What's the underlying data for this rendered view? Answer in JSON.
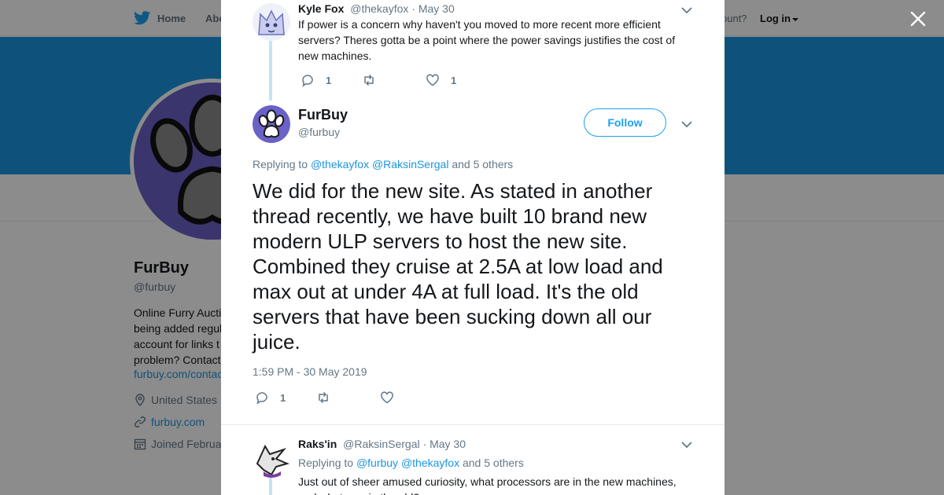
{
  "background": {
    "nav": {
      "home_label": "Home",
      "about_label": "Abo",
      "account_prompt": "ccount?",
      "login_label": "Log in"
    },
    "profile": {
      "name": "FurBuy",
      "handle": "@furbuy",
      "bio": "Online Furry Aucti\nbeing added regul\naccount for links t\nproblem? Contact",
      "bio_link": "furbuy.com/contac",
      "location": "United States",
      "website": "furbuy.com",
      "joined": "Joined Februa"
    },
    "colors": {
      "banner": "#1b95e0",
      "link": "#1b95e0",
      "avatar_purple": "#6a62c7"
    }
  },
  "modal": {
    "parent_tweet": {
      "name": "Kyle Fox",
      "handle": "@thekayfox",
      "date": "· May 30",
      "text": "If power is a concern why haven't you moved to more recent more efficient servers?  Theres gotta be a point where the power savings justifies the cost of new machines.",
      "reply_count": "1",
      "retweet_count": "",
      "like_count": "1"
    },
    "main_tweet": {
      "name": "FurBuy",
      "handle": "@furbuy",
      "follow_label": "Follow",
      "replying_prefix": "Replying to",
      "mention_1": "@thekayfox",
      "mention_2": "@RaksinSergal",
      "replying_suffix": "and 5 others",
      "text": "We did for the new site. As stated in another thread recently, we have built 10 brand new modern ULP servers to host the new site. Combined they cruise at 2.5A at low load and max out at under 4A at full load. It's the old servers that have been sucking down all our juice.",
      "timestamp": "1:59 PM - 30 May 2019",
      "reply_count": "1",
      "retweet_count": "",
      "like_count": ""
    },
    "reply_tweet": {
      "name": "Raks'in",
      "handle": "@RaksinSergal",
      "date": "· May 30",
      "replying_prefix": "Replying to",
      "mention_1": "@furbuy",
      "mention_2": "@thekayfox",
      "replying_suffix": "and 5 others",
      "text": "Just out of sheer amused curiosity, what processors are in the new machines, and what was in the old?"
    },
    "icons": [
      "close-icon",
      "twitter-bird-icon",
      "chevron-down-icon",
      "reply-icon",
      "retweet-icon",
      "like-icon",
      "location-icon",
      "link-icon",
      "calendar-icon"
    ]
  }
}
